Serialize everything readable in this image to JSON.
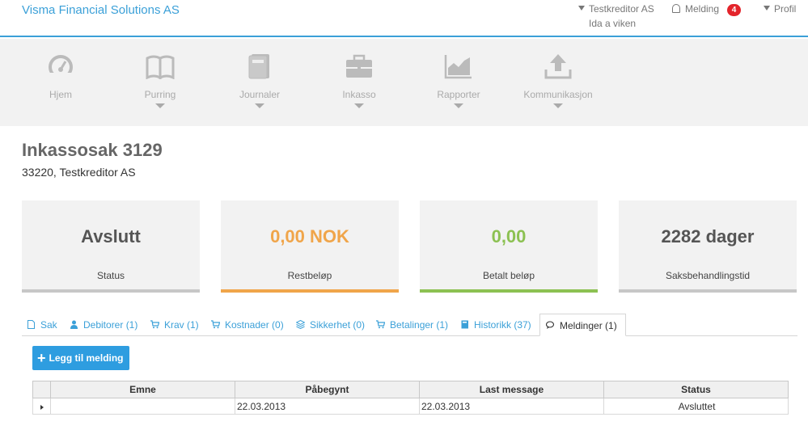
{
  "header": {
    "brand": "Visma Financial Solutions AS",
    "creditor": "Testkreditor AS",
    "user": "Ida a viken",
    "melding_label": "Melding",
    "melding_count": "4",
    "profil_label": "Profil"
  },
  "nav": [
    {
      "label": "Hjem",
      "icon": "dashboard-icon",
      "has_caret": false
    },
    {
      "label": "Purring",
      "icon": "book-icon",
      "has_caret": true
    },
    {
      "label": "Journaler",
      "icon": "journal-icon",
      "has_caret": true
    },
    {
      "label": "Inkasso",
      "icon": "briefcase-icon",
      "has_caret": true
    },
    {
      "label": "Rapporter",
      "icon": "area-chart-icon",
      "has_caret": true
    },
    {
      "label": "Kommunikasjon",
      "icon": "upload-icon",
      "has_caret": true
    }
  ],
  "page": {
    "title": "Inkassosak 3129",
    "subtitle": "33220, Testkreditor AS"
  },
  "cards": [
    {
      "value": "Avslutt",
      "caption": "Status",
      "value_color": "#555555",
      "bar_color": "#c7c7c7"
    },
    {
      "value": "0,00 NOK",
      "caption": "Restbeløp",
      "value_color": "#f0a54a",
      "bar_color": "#f0a54a"
    },
    {
      "value": "0,00",
      "caption": "Betalt beløp",
      "value_color": "#8cc152",
      "bar_color": "#8cc152"
    },
    {
      "value": "2282 dager",
      "caption": "Saksbehandlingstid",
      "value_color": "#555555",
      "bar_color": "#c7c7c7"
    }
  ],
  "tabs": [
    {
      "label": "Sak",
      "icon": "document-icon"
    },
    {
      "label": "Debitorer (1)",
      "icon": "user-icon"
    },
    {
      "label": "Krav (1)",
      "icon": "cart-icon"
    },
    {
      "label": "Kostnader (0)",
      "icon": "cart-icon"
    },
    {
      "label": "Sikkerhet (0)",
      "icon": "layers-icon"
    },
    {
      "label": "Betalinger (1)",
      "icon": "cart-icon"
    },
    {
      "label": "Historikk (37)",
      "icon": "book-icon"
    },
    {
      "label": "Meldinger (1)",
      "icon": "chat-icon",
      "active": true
    }
  ],
  "add_button": {
    "label": "Legg til melding"
  },
  "table": {
    "columns": [
      "Emne",
      "Påbegynt",
      "Last message",
      "Status"
    ],
    "rows": [
      [
        "",
        "22.03.2013",
        "22.03.2013",
        "Avsluttet"
      ]
    ]
  },
  "colors": {
    "accent": "#3ba0d8",
    "button": "#2e9de0",
    "badge": "#e3242b"
  }
}
